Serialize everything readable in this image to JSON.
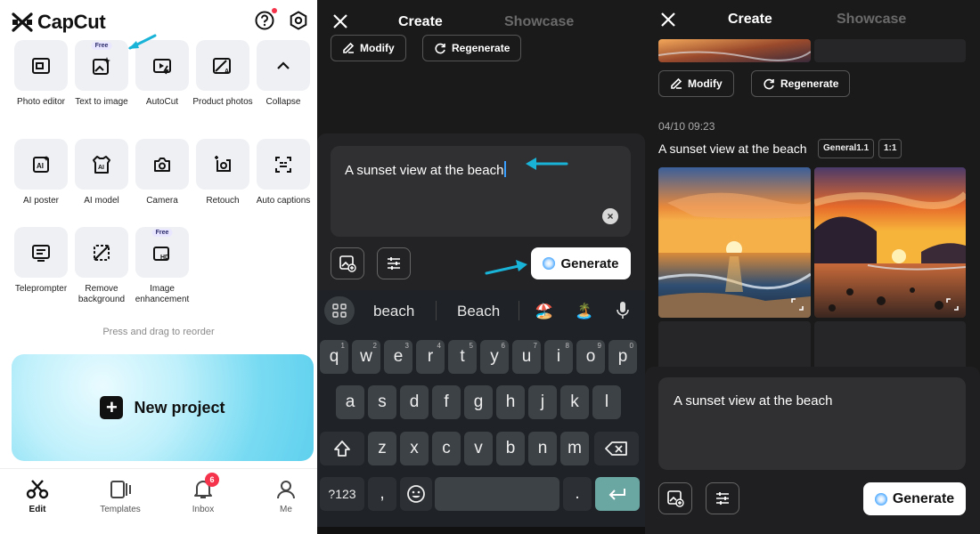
{
  "panel_edit": {
    "app_name": "CapCut",
    "tiles": [
      {
        "label": "Photo editor",
        "icon": "photo-editor-icon"
      },
      {
        "label": "Text to image",
        "icon": "text-to-image-icon",
        "badge": "Free"
      },
      {
        "label": "AutoCut",
        "icon": "autocut-icon"
      },
      {
        "label": "Product photos",
        "icon": "product-photos-icon"
      },
      {
        "label": "Collapse",
        "icon": "chevron-up-icon"
      },
      {
        "label": "AI poster",
        "icon": "ai-poster-icon"
      },
      {
        "label": "AI model",
        "icon": "ai-model-icon"
      },
      {
        "label": "Camera",
        "icon": "camera-icon"
      },
      {
        "label": "Retouch",
        "icon": "retouch-icon"
      },
      {
        "label": "Auto captions",
        "icon": "auto-captions-icon"
      },
      {
        "label": "Teleprompter",
        "icon": "teleprompter-icon"
      },
      {
        "label": "Remove background",
        "icon": "remove-background-icon"
      },
      {
        "label": "Image enhancement",
        "icon": "image-enhancement-icon",
        "badge": "Free"
      }
    ],
    "reorder_hint": "Press and drag to reorder",
    "new_project_label": "New project",
    "nav": [
      {
        "label": "Edit",
        "icon": "scissors-icon",
        "active": true
      },
      {
        "label": "Templates",
        "icon": "templates-icon"
      },
      {
        "label": "Inbox",
        "icon": "bell-icon",
        "badge": "6"
      },
      {
        "label": "Me",
        "icon": "user-icon"
      }
    ]
  },
  "panel_prompt": {
    "tab_create": "Create",
    "tab_showcase": "Showcase",
    "modify_label": "Modify",
    "regenerate_label": "Regenerate",
    "prompt_text": "A sunset view at the beach",
    "generate_label": "Generate",
    "suggestions": [
      "beach",
      "Beach",
      "🏖️",
      "🏝️"
    ],
    "keys_row1": [
      {
        "k": "q",
        "alt": "1"
      },
      {
        "k": "w",
        "alt": "2"
      },
      {
        "k": "e",
        "alt": "3"
      },
      {
        "k": "r",
        "alt": "4"
      },
      {
        "k": "t",
        "alt": "5"
      },
      {
        "k": "y",
        "alt": "6"
      },
      {
        "k": "u",
        "alt": "7"
      },
      {
        "k": "i",
        "alt": "8"
      },
      {
        "k": "o",
        "alt": "9"
      },
      {
        "k": "p",
        "alt": "0"
      }
    ],
    "keys_row2": [
      "a",
      "s",
      "d",
      "f",
      "g",
      "h",
      "j",
      "k",
      "l"
    ],
    "keys_row3": [
      "z",
      "x",
      "c",
      "v",
      "b",
      "n",
      "m"
    ],
    "key_123": "?123",
    "key_comma": ",",
    "key_period": "."
  },
  "panel_results": {
    "tab_create": "Create",
    "tab_showcase": "Showcase",
    "modify_label": "Modify",
    "regenerate_label": "Regenerate",
    "timestamp": "04/10 09:23",
    "caption": "A sunset view at the beach",
    "model_tag": "General1.1",
    "ratio_tag": "1:1",
    "prompt_text": "A sunset view at the beach",
    "generate_label": "Generate"
  },
  "colors": {
    "accent_cyan": "#19b3d8",
    "dark_bg": "#1a1a1a",
    "badge_red": "#f5334a"
  }
}
